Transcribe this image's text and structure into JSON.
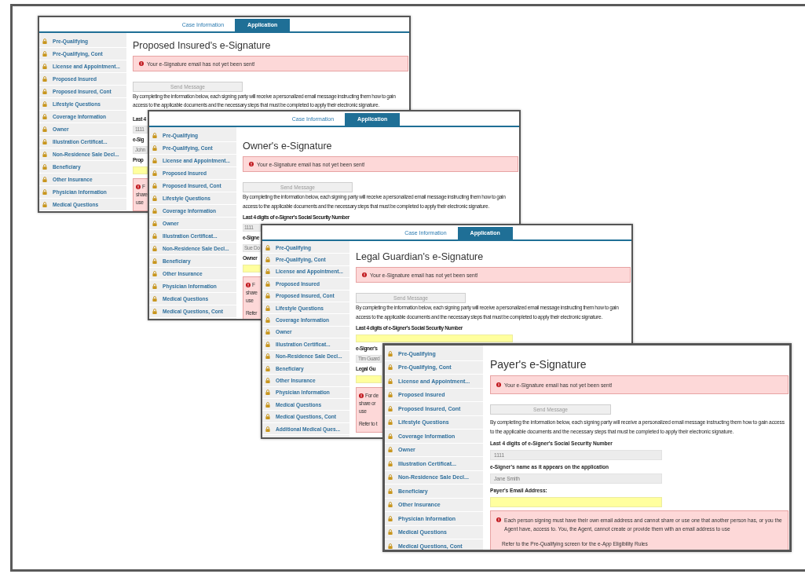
{
  "windows": [
    {
      "tabs": [
        {
          "label": "Case Information",
          "selected": false
        },
        {
          "label": "Application",
          "selected": true
        }
      ],
      "sidebar": [
        {
          "label": "Pre-Qualifying",
          "locked": true
        },
        {
          "label": "Pre-Qualifying, Cont",
          "locked": true
        },
        {
          "label": "License and Appointment...",
          "locked": true
        },
        {
          "label": "Proposed Insured",
          "locked": true
        },
        {
          "label": "Proposed Insured, Cont",
          "locked": true
        },
        {
          "label": "Lifestyle Questions",
          "locked": true
        },
        {
          "label": "Coverage Information",
          "locked": true
        },
        {
          "label": "Owner",
          "locked": true
        },
        {
          "label": "Illustration Certificat...",
          "locked": true
        },
        {
          "label": "Non-Residence Sale Decl...",
          "locked": true
        },
        {
          "label": "Beneficiary",
          "locked": true
        },
        {
          "label": "Other Insurance",
          "locked": true
        },
        {
          "label": "Physician Information",
          "locked": true
        },
        {
          "label": "Medical Questions",
          "locked": true
        }
      ],
      "title": "Proposed Insured's e-Signature",
      "alert": "Your e-Signature email has not yet been sent!",
      "send_button": {
        "label": "Send Message",
        "disabled": true
      },
      "intro": "By completing the information below, each signing party will receive a personalized email message instructing them how to gain access to the applicable documents and the necessary steps that must be completed to apply their electronic signature.",
      "fields": [
        {
          "label": "Last 4",
          "value": "1111",
          "highlighted": false
        },
        {
          "label": "e-Sig",
          "value": "John",
          "highlighted": false
        },
        {
          "label": "Prop",
          "highlighted": true
        }
      ],
      "notice": {
        "lines": [
          "F",
          "share",
          "use"
        ]
      }
    },
    {
      "tabs": [
        {
          "label": "Case Information",
          "selected": false
        },
        {
          "label": "Application",
          "selected": true
        }
      ],
      "sidebar": [
        {
          "label": "Pre-Qualifying",
          "locked": true
        },
        {
          "label": "Pre-Qualifying, Cont",
          "locked": true
        },
        {
          "label": "License and Appointment...",
          "locked": true
        },
        {
          "label": "Proposed Insured",
          "locked": true
        },
        {
          "label": "Proposed Insured, Cont",
          "locked": true
        },
        {
          "label": "Lifestyle Questions",
          "locked": true
        },
        {
          "label": "Coverage Information",
          "locked": true
        },
        {
          "label": "Owner",
          "locked": true
        },
        {
          "label": "Illustration Certificat...",
          "locked": true
        },
        {
          "label": "Non-Residence Sale Decl...",
          "locked": true
        },
        {
          "label": "Beneficiary",
          "locked": true
        },
        {
          "label": "Other Insurance",
          "locked": true
        },
        {
          "label": "Physician Information",
          "locked": true
        },
        {
          "label": "Medical Questions",
          "locked": true
        },
        {
          "label": "Medical Questions, Cont",
          "locked": true
        }
      ],
      "title": "Owner's e-Signature",
      "alert": "Your e-Signature email has not yet been sent!",
      "send_button": {
        "label": "Send Message",
        "disabled": true
      },
      "intro": "By completing the information below, each signing party will receive a personalized email message instructing them how to gain access to the applicable documents and the necessary steps that must be completed to apply their electronic signature.",
      "fields": [
        {
          "label": "Last 4 digits of e-Signer's Social Security Number",
          "value": "1111",
          "highlighted": false
        },
        {
          "label": "e-Signe",
          "value": "Sue Do",
          "highlighted": false
        },
        {
          "label": "Owner",
          "highlighted": true
        }
      ],
      "notice": {
        "lines": [
          "F",
          "share",
          "use"
        ],
        "footer": "Refer"
      }
    },
    {
      "tabs": [
        {
          "label": "Case Information",
          "selected": false
        },
        {
          "label": "Application",
          "selected": true
        }
      ],
      "sidebar": [
        {
          "label": "Pre-Qualifying",
          "locked": true
        },
        {
          "label": "Pre-Qualifying, Cont",
          "locked": true
        },
        {
          "label": "License and Appointment...",
          "locked": true
        },
        {
          "label": "Proposed Insured",
          "locked": true
        },
        {
          "label": "Proposed Insured, Cont",
          "locked": true
        },
        {
          "label": "Lifestyle Questions",
          "locked": true
        },
        {
          "label": "Coverage Information",
          "locked": true
        },
        {
          "label": "Owner",
          "locked": true
        },
        {
          "label": "Illustration Certificat...",
          "locked": true
        },
        {
          "label": "Non-Residence Sale Decl...",
          "locked": true
        },
        {
          "label": "Beneficiary",
          "locked": true
        },
        {
          "label": "Other Insurance",
          "locked": true
        },
        {
          "label": "Physician Information",
          "locked": true
        },
        {
          "label": "Medical Questions",
          "locked": true
        },
        {
          "label": "Medical Questions, Cont",
          "locked": true
        },
        {
          "label": "Additional Medical Ques...",
          "locked": true
        }
      ],
      "title": "Legal Guardian's e-Signature",
      "alert": "Your e-Signature email has not yet been sent!",
      "send_button": {
        "label": "Send Message",
        "disabled": true
      },
      "intro": "By completing the information below, each signing party will receive a personalized email message instructing them how to gain access to the applicable documents and the necessary steps that must be completed to apply their electronic signature.",
      "fields": [
        {
          "label": "Last 4 digits of e-Signer's Social Security Number",
          "highlighted": true
        },
        {
          "label": "e-Signer's",
          "value": "Tim Guard",
          "highlighted": false
        },
        {
          "label": "Legal Gu",
          "highlighted": true
        }
      ],
      "notice": {
        "lines": [
          "For de",
          "share or",
          "use"
        ],
        "footer": "Refer to t"
      }
    },
    {
      "sidebar": [
        {
          "label": "Pre-Qualifying",
          "locked": true
        },
        {
          "label": "Pre-Qualifying, Cont",
          "locked": true
        },
        {
          "label": "License and Appointment...",
          "locked": true
        },
        {
          "label": "Proposed Insured",
          "locked": true
        },
        {
          "label": "Proposed Insured, Cont",
          "locked": true
        },
        {
          "label": "Lifestyle Questions",
          "locked": true
        },
        {
          "label": "Coverage Information",
          "locked": true
        },
        {
          "label": "Owner",
          "locked": true
        },
        {
          "label": "Illustration Certificat...",
          "locked": true
        },
        {
          "label": "Non-Residence Sale Decl...",
          "locked": true
        },
        {
          "label": "Beneficiary",
          "locked": true
        },
        {
          "label": "Other Insurance",
          "locked": true
        },
        {
          "label": "Physician Information",
          "locked": true
        },
        {
          "label": "Medical Questions",
          "locked": true
        },
        {
          "label": "Medical Questions, Cont",
          "locked": true
        }
      ],
      "title": "Payer's e-Signature",
      "alert": "Your e-Signature email has not yet been sent!",
      "send_button": {
        "label": "Send Message",
        "disabled": true
      },
      "intro": "By completing the information below, each signing party will receive a personalized email message instructing them how to gain access to the applicable documents and the necessary steps that must be completed to apply their electronic signature.",
      "fields": [
        {
          "label": "Last 4 digits of e-Signer's Social Security Number",
          "value": "1111",
          "highlighted": false
        },
        {
          "label": "e-Signer's name as it appears on the application",
          "value": "Jane Smith",
          "highlighted": false
        },
        {
          "label": "Payer's Email Address:",
          "highlighted": true
        }
      ],
      "notice": {
        "lines": [
          "Each person signing must have their own email address and cannot share or use one that another person has, or you the Agent have, access to. You, the Agent, cannot create or provide them with an email address to use"
        ],
        "footer": "Refer to the Pre-Qualifying screen for the e-App Eligibility Rules"
      }
    }
  ]
}
